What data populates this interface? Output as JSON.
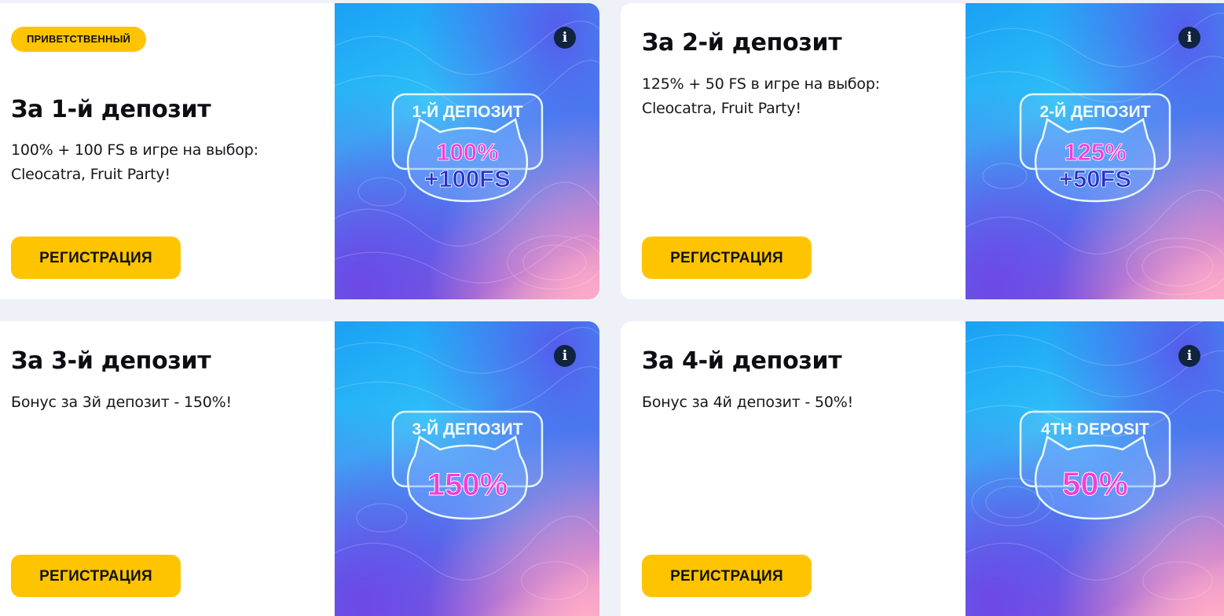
{
  "colors": {
    "accent": "#ffc400",
    "info_bg": "#10233f",
    "value_magenta": "#ff3ad8",
    "value_navy": "#2a30c8"
  },
  "cards": [
    {
      "badge": "ПРИВЕТСТВЕННЫЙ",
      "title": "За 1-й депозит",
      "description_lines": [
        "100% + 100 FS в игре на выбор:",
        "Cleocatra, Fruit Party!"
      ],
      "button": "РЕГИСТРАЦИЯ",
      "info_icon": "i",
      "emblem": {
        "label": "1-Й ДЕПОЗИТ",
        "line1": "100%",
        "line2": "+100FS"
      }
    },
    {
      "title": "За 2-й депозит",
      "description_lines": [
        "125% + 50 FS в игре на выбор:",
        "Cleocatra, Fruit Party!"
      ],
      "button": "РЕГИСТРАЦИЯ",
      "info_icon": "i",
      "emblem": {
        "label": "2-Й ДЕПОЗИТ",
        "line1": "125%",
        "line2": "+50FS"
      }
    },
    {
      "title": "За 3-й депозит",
      "description_lines": [
        "Бонус за 3й депозит - 150%!"
      ],
      "button": "РЕГИСТРАЦИЯ",
      "info_icon": "i",
      "emblem": {
        "label": "3-Й ДЕПОЗИТ",
        "line1": "150%"
      }
    },
    {
      "title": "За 4-й депозит",
      "description_lines": [
        "Бонус за 4й депозит - 50%!"
      ],
      "button": "РЕГИСТРАЦИЯ",
      "info_icon": "i",
      "emblem": {
        "label": "4TH DEPOSIT",
        "line1": "50%"
      }
    }
  ]
}
